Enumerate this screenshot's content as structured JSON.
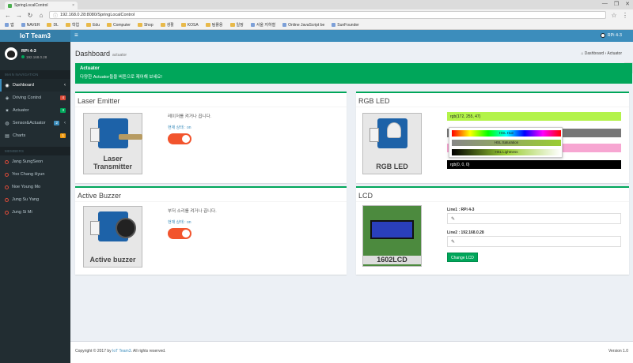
{
  "browser": {
    "tab_title": "SpringLocalControl",
    "tab_close": "×",
    "window_controls": [
      "—",
      "❐",
      "✕"
    ],
    "url": "192.168.0.28:8080/SpringLocalControl",
    "bookmarks": [
      "앱",
      "NAVER",
      "DL",
      "학업",
      "Edu",
      "Computer",
      "Shop",
      "생활",
      "KOSA",
      "팀플용",
      "일정",
      "서울 지하철",
      "Online JavaScript be",
      "SunFounder"
    ]
  },
  "sidebar": {
    "brand": "IoT Team3",
    "user_name": "RPi 4-3",
    "user_status": "192.168.0.28",
    "section_main": "MAIN NAVIGATION",
    "items": [
      {
        "label": "Dashboard",
        "icon": "dashboard-icon",
        "glyph": "◉",
        "chev": "‹"
      },
      {
        "label": "Driving Control",
        "icon": "car-icon",
        "glyph": "◈",
        "badge": "4",
        "badge_color": "#dd4b39"
      },
      {
        "label": "Actuator",
        "icon": "gear-icon",
        "glyph": "✷",
        "badge": "3",
        "badge_color": "#00a65a"
      },
      {
        "label": "Sensor&Actuator",
        "icon": "sensor-icon",
        "glyph": "◍",
        "badge": "2",
        "badge_color": "#3c8dbc",
        "chev": "‹"
      },
      {
        "label": "Charts",
        "icon": "chart-icon",
        "glyph": "▤",
        "badge": "1",
        "badge_color": "#f39c12"
      }
    ],
    "section_team": "MEMBERS",
    "members": [
      "Jang SungSeon",
      "Yoo Chang Hyun",
      "Noe Young Mo",
      "Jung Su Yang",
      "Jung Si Mi"
    ]
  },
  "header": {
    "menu_icon": "≡",
    "user": "RPi 4-3",
    "page_title": "Dashboard",
    "page_subtitle": "actuator",
    "breadcrumb": "⌂ Dashboard › Actuator"
  },
  "callout": {
    "title": "Actuator",
    "text": "다양한 Actuator들을 버튼으로 제어해 보세요!"
  },
  "laser": {
    "title": "Laser Emitter",
    "image_caption": "Laser Transmitter",
    "desc": "레이저를 켜거나 끕니다.",
    "state": "현재 상태 : on"
  },
  "buzzer": {
    "title": "Active Buzzer",
    "image_caption": "Active buzzer",
    "desc": "부저 소리를 켜거나 끕니다.",
    "state": "현재 상태 : on"
  },
  "rgb": {
    "title": "RGB LED",
    "image_caption": "RGB LED",
    "bar1": "rgb(172, 255, 47)",
    "bar1_color": "#b3f34a",
    "bar2_color": "#777777",
    "bar3_color": "#f7a6d2",
    "bar4": "rgb(0, 0, 0)",
    "bar4_color": "#000000",
    "slider_hue": "HSL Hue",
    "slider_sat": "HSL Saturation",
    "slider_light": "HSL Lightness"
  },
  "lcd": {
    "title": "LCD",
    "image_caption": "1602LCD",
    "line1_label": "Line1 : RPi 4-3",
    "line2_label": "Line2 : 192.168.0.28",
    "button": "Change LCD",
    "edit_glyph": "✎"
  },
  "footer": {
    "copyright_prefix": "Copyright © 2017 by ",
    "team_link": "IoT Team3",
    "copyright_suffix": ". All rights reserved.",
    "version": "Version 1.0"
  },
  "colors": {
    "primary": "#3c8dbc",
    "success": "#00a65a",
    "sidebar": "#222d32",
    "toggle": "#f2542d"
  }
}
